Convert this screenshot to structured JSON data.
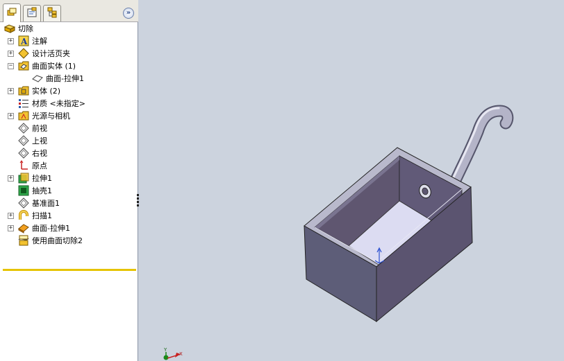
{
  "tabs": [
    {
      "name": "feature-manager",
      "icon": "feature-manager-icon"
    },
    {
      "name": "property-manager",
      "icon": "property-manager-icon"
    },
    {
      "name": "configuration-manager",
      "icon": "configuration-manager-icon"
    }
  ],
  "expand_icon": "»",
  "tree": {
    "root": {
      "label": "切除",
      "icon": "part-icon"
    },
    "items": [
      {
        "label": "注解",
        "icon": "annotations-icon",
        "expander": "+"
      },
      {
        "label": "设计活页夹",
        "icon": "design-binder-icon",
        "expander": "+"
      },
      {
        "label": "曲面实体 (1)",
        "icon": "surface-bodies-folder-icon",
        "expander": "−"
      },
      {
        "label": "曲面-拉伸1",
        "icon": "surface-body-icon",
        "expander": ""
      },
      {
        "label": "实体 (2)",
        "icon": "solid-bodies-folder-icon",
        "expander": "+"
      },
      {
        "label": "材质 <未指定>",
        "icon": "material-icon",
        "expander": ""
      },
      {
        "label": "光源与相机",
        "icon": "lights-cameras-icon",
        "expander": "+"
      },
      {
        "label": "前视",
        "icon": "plane-icon",
        "expander": ""
      },
      {
        "label": "上视",
        "icon": "plane-icon",
        "expander": ""
      },
      {
        "label": "右视",
        "icon": "plane-icon",
        "expander": ""
      },
      {
        "label": "原点",
        "icon": "origin-icon",
        "expander": ""
      },
      {
        "label": "拉伸1",
        "icon": "extrude-icon",
        "expander": "+"
      },
      {
        "label": "抽壳1",
        "icon": "shell-icon",
        "expander": ""
      },
      {
        "label": "基准面1",
        "icon": "plane-icon",
        "expander": ""
      },
      {
        "label": "扫描1",
        "icon": "sweep-icon",
        "expander": "+"
      },
      {
        "label": "曲面-拉伸1",
        "icon": "surface-extrude-icon",
        "expander": "+"
      },
      {
        "label": "使用曲面切除2",
        "icon": "surface-cut-icon",
        "expander": ""
      }
    ]
  },
  "triad": {
    "x_label": "X",
    "y_label": "Y"
  },
  "colors": {
    "viewport_bg": "#ccd3de",
    "model_face": "#5f5670",
    "model_top": "#8a8aa4",
    "cavity_floor": "#dcdcf2",
    "rollback_bar": "#e6c300"
  }
}
